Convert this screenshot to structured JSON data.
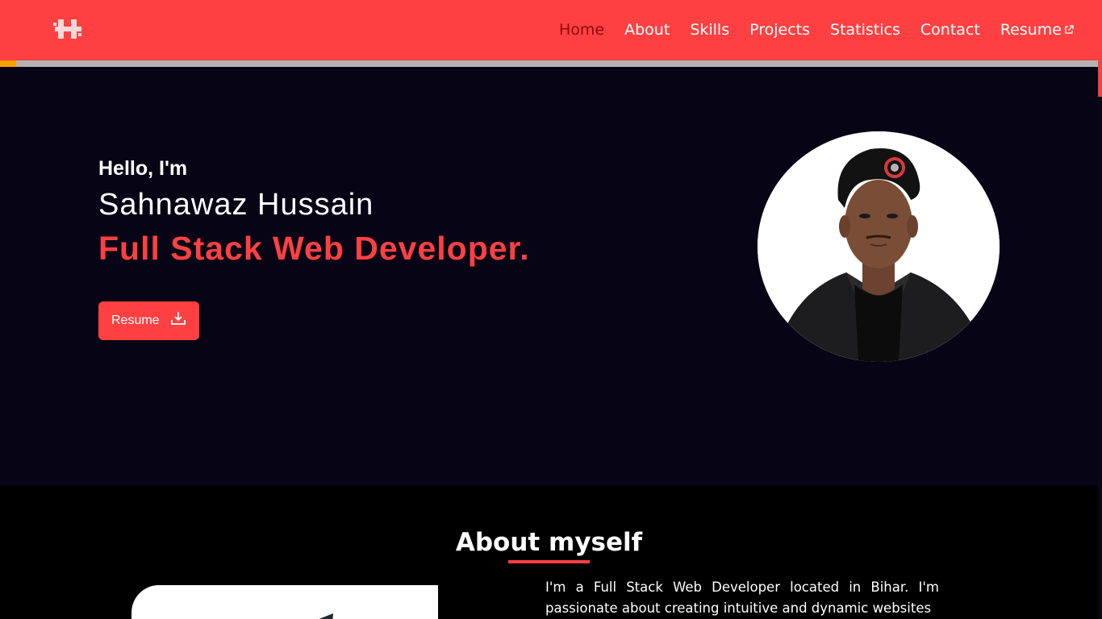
{
  "nav": {
    "logo_icon": "hs-monogram-logo",
    "links": [
      {
        "label": "Home",
        "active": true
      },
      {
        "label": "About",
        "active": false
      },
      {
        "label": "Skills",
        "active": false
      },
      {
        "label": "Projects",
        "active": false
      },
      {
        "label": "Statistics",
        "active": false
      },
      {
        "label": "Contact",
        "active": false
      },
      {
        "label": "Resume",
        "active": false,
        "icon": "external-link-icon"
      }
    ]
  },
  "scroll_progress": 0.015,
  "hero": {
    "greeting": "Hello, I'm",
    "name": "Sahnawaz Hussain",
    "role": "Full Stack Web Developer.",
    "resume_button": "Resume",
    "resume_icon": "download-icon",
    "photo_icon": "profile-photo"
  },
  "about": {
    "title": "About myself",
    "text": "I'm a Full Stack Web Developer located in Bihar. I'm passionate about creating intuitive and dynamic websites"
  },
  "colors": {
    "accent": "#fe4042",
    "hero_bg": "#070415",
    "active_link": "#8a0a10",
    "progress": "#f6a000"
  }
}
